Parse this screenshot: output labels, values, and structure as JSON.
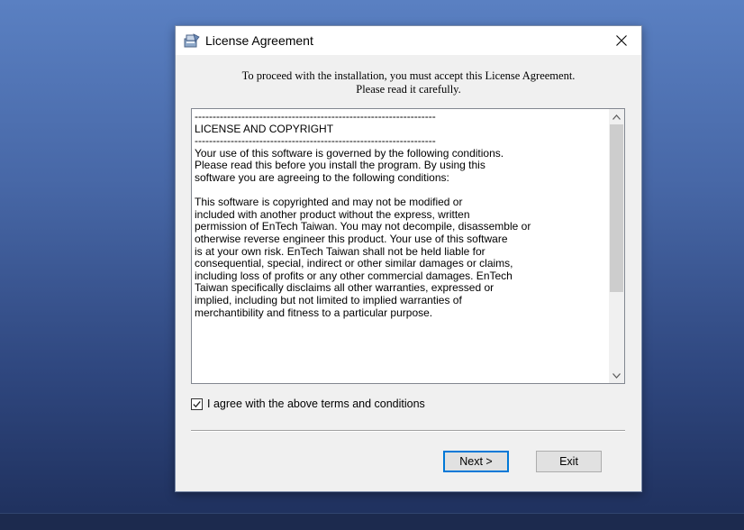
{
  "window": {
    "title": "License Agreement",
    "close_glyph": "×",
    "app_icon": "installer-icon"
  },
  "intro": {
    "line1": "To proceed with the installation, you must accept this License Agreement.",
    "line2": "Please read it carefully."
  },
  "license": {
    "text": "-------------------------------------------------------------------\nLICENSE AND COPYRIGHT\n-------------------------------------------------------------------\nYour use of this software is governed by the following conditions.\nPlease read this before you install the program. By using this\nsoftware you are agreeing to the following conditions:\n\nThis software is copyrighted and may not be modified or\nincluded with another product without the express, written\npermission of EnTech Taiwan. You may not decompile, disassemble or\notherwise reverse engineer this product. Your use of this software\nis at your own risk. EnTech Taiwan shall not be held liable for\nconsequential, special, indirect or other similar damages or claims,\nincluding loss of profits or any other commercial damages. EnTech\nTaiwan specifically disclaims all other warranties, expressed or\nimplied, including but not limited to implied warranties of\nmerchantibility and fitness to a particular purpose.",
    "scroll_up_icon": "chevron-up-icon",
    "scroll_down_icon": "chevron-down-icon"
  },
  "agree": {
    "label": "I agree with the above terms and conditions",
    "checked": true
  },
  "buttons": {
    "next": "Next >",
    "exit": "Exit"
  },
  "colors": {
    "desktop_top": "#5a80c2",
    "desktop_bottom": "#1e2f5b",
    "dialog_bg": "#f0f0f0",
    "focus_border": "#0078d7"
  }
}
